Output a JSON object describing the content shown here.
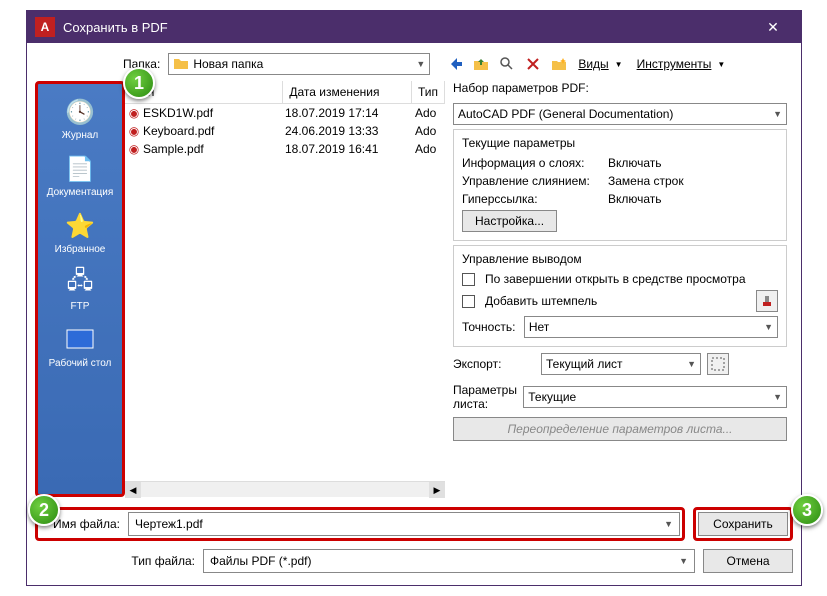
{
  "window": {
    "title": "Сохранить в PDF"
  },
  "toolbar": {
    "folder_label": "Папка:",
    "folder_value": "Новая папка",
    "views_label": "Виды",
    "tools_label": "Инструменты"
  },
  "places": [
    {
      "label": "Журнал",
      "icon": "clock"
    },
    {
      "label": "Документация",
      "icon": "doc"
    },
    {
      "label": "Избранное",
      "icon": "star"
    },
    {
      "label": "FTP",
      "icon": "ftp"
    },
    {
      "label": "Рабочий стол",
      "icon": "desktop"
    }
  ],
  "headers": {
    "name": "Имя",
    "date": "Дата изменения",
    "type": "Тип"
  },
  "files": [
    {
      "name": "ESKD1W.pdf",
      "date": "18.07.2019 17:14",
      "type": "Ado"
    },
    {
      "name": "Keyboard.pdf",
      "date": "24.06.2019 13:33",
      "type": "Ado"
    },
    {
      "name": "Sample.pdf",
      "date": "18.07.2019 16:41",
      "type": "Ado"
    }
  ],
  "pdf": {
    "preset_label": "Набор параметров PDF:",
    "preset_value": "AutoCAD PDF (General Documentation)",
    "current_params": "Текущие параметры",
    "layer_info_label": "Информация о слоях:",
    "layer_info_value": "Включать",
    "merge_label": "Управление слиянием:",
    "merge_value": "Замена строк",
    "hyperlink_label": "Гиперссылка:",
    "hyperlink_value": "Включать",
    "settings_btn": "Настройка...",
    "output_control": "Управление выводом",
    "open_after_label": "По завершении открыть в средстве просмотра",
    "stamp_label": "Добавить штемпель",
    "precision_label": "Точность:",
    "precision_value": "Нет",
    "export_label": "Экспорт:",
    "export_value": "Текущий лист",
    "sheet_params_label": "Параметры листа:",
    "sheet_params_value": "Текущие",
    "sheet_override": "Переопределение параметров листа..."
  },
  "bottom": {
    "filename_label": "Имя файла:",
    "filename_value": "Чертеж1.pdf",
    "filetype_label": "Тип файла:",
    "filetype_value": "Файлы PDF (*.pdf)",
    "save_btn": "Сохранить",
    "cancel_btn": "Отмена"
  },
  "callouts": {
    "c1": "1",
    "c2": "2",
    "c3": "3"
  }
}
